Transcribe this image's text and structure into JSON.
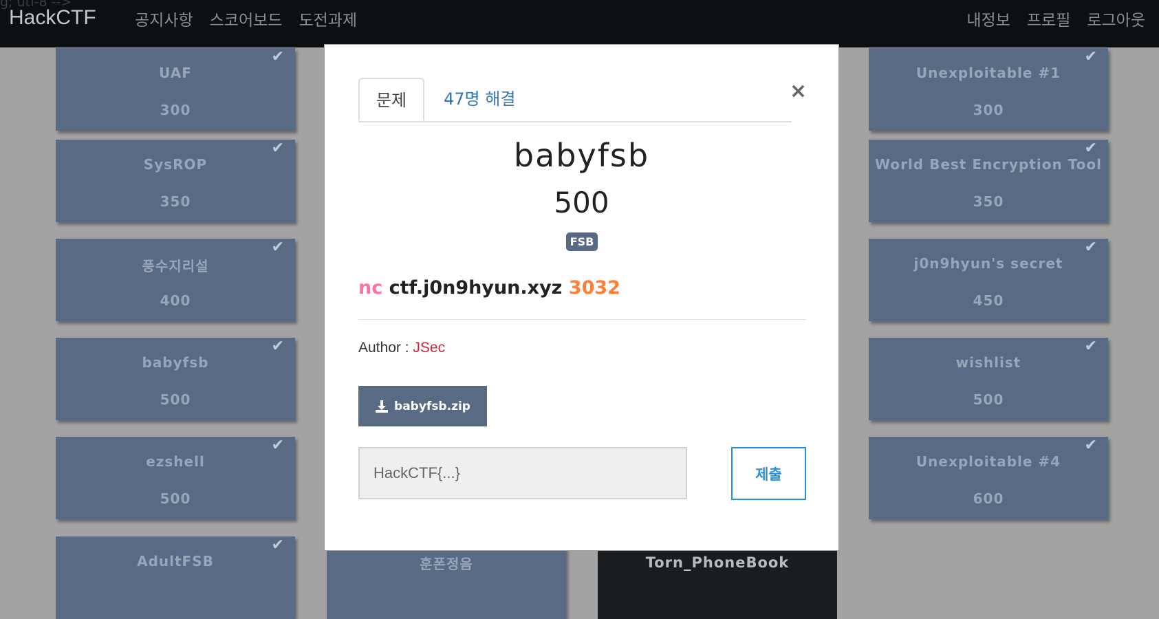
{
  "stray_text": "g; utf-8 -->",
  "navbar": {
    "brand": "HackCTF",
    "left_links": [
      "공지사항",
      "스코어보드",
      "도전과제"
    ],
    "right_links": [
      "내정보",
      "프로필",
      "로그아웃"
    ]
  },
  "challenges": {
    "left": [
      {
        "name": "UAF",
        "points": "300"
      },
      {
        "name": "SysROP",
        "points": "350"
      },
      {
        "name": "풍수지리설",
        "points": "400"
      },
      {
        "name": "babyfsb",
        "points": "500"
      },
      {
        "name": "ezshell",
        "points": "500"
      },
      {
        "name": "AdultFSB",
        "points": ""
      }
    ],
    "right": [
      {
        "name": "Unexploitable #1",
        "points": "300"
      },
      {
        "name": "World Best Encryption Tool",
        "points": "350"
      },
      {
        "name": "j0n9hyun's secret",
        "points": "450"
      },
      {
        "name": "wishlist",
        "points": "500"
      },
      {
        "name": "Unexploitable #4",
        "points": "600"
      }
    ],
    "bottom_middle": {
      "name": "훈폰정음"
    },
    "bottom_dark": {
      "name": "Torn_PhoneBook"
    },
    "check_icon": "✔"
  },
  "modal": {
    "tabs": {
      "problem": "문제",
      "solves": "47명 해결"
    },
    "close": "×",
    "title": "babyfsb",
    "points": "500",
    "tag": "FSB",
    "connection": {
      "cmd": "nc",
      "host": "ctf.j0n9hyun.xyz",
      "port": "3032"
    },
    "author_label": "Author :",
    "author_name": "JSec",
    "download_label": "babyfsb.zip",
    "flag_placeholder": "HackCTF{...}",
    "submit_label": "제출"
  }
}
